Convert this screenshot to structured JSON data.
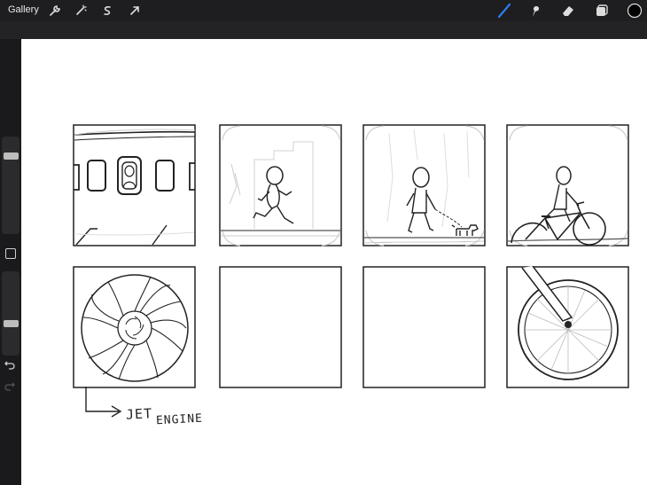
{
  "app": {
    "gallery_label": "Gallery"
  },
  "toolbar": {
    "left_tools": [
      "wrench-icon",
      "magic-wand-icon",
      "selection-icon",
      "transform-arrow-icon"
    ],
    "right_tools": [
      "brush-icon",
      "smudge-icon",
      "eraser-icon",
      "layers-icon",
      "color-swatch-icon"
    ],
    "accent_color": "#2f7cf6",
    "current_color": "#000000"
  },
  "sidebar": {
    "controls": [
      "brush-size-slider",
      "modify-button",
      "opacity-slider",
      "undo-button",
      "redo-button"
    ]
  },
  "canvas": {
    "storyboard_rows": 2,
    "storyboard_columns": 4,
    "panels": [
      "airplane-windows",
      "running-figure",
      "walking-dog",
      "biking-figure",
      "jet-engine",
      "empty",
      "empty",
      "bicycle-wheel"
    ],
    "annotation": {
      "word1": "JET",
      "word2": "ENGINE"
    }
  }
}
